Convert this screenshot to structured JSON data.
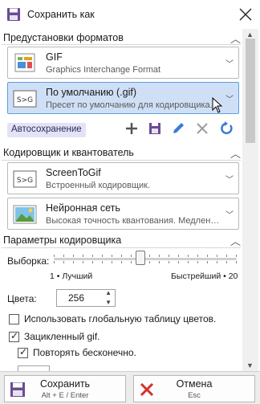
{
  "window": {
    "title": "Сохранить как"
  },
  "presets": {
    "header": "Предустановки форматов",
    "format": {
      "name": "GIF",
      "description": "Graphics Interchange Format"
    },
    "preset": {
      "name": "По умолчанию (.gif)",
      "description": "Пресет по умолчанию для кодировщика."
    },
    "autosave_label": "Автосохранение"
  },
  "encoder": {
    "header": "Кодировщик и квантователь",
    "encoder_item": {
      "name": "ScreenToGif",
      "description": "Встроенный кодировщик."
    },
    "quantizer_item": {
      "name": "Нейронная сеть",
      "description": "Высокая точность квантования. Медлен…"
    }
  },
  "params": {
    "header": "Параметры кодировщика",
    "sampling_label": "Выборка:",
    "sampling_min": "1 • Лучший",
    "sampling_max": "Быстрейший • 20",
    "sampling_value": 10,
    "colors_label": "Цвета:",
    "colors_value": "256",
    "global_table_label": "Использовать глобальную таблицу цветов.",
    "global_table_checked": false,
    "looped_label": "Зацикленный gif.",
    "looped_checked": true,
    "repeat_forever_label": "Повторять бесконечно.",
    "repeat_forever_checked": true
  },
  "footer": {
    "save_label": "Сохранить",
    "save_shortcut": "Alt + E / Enter",
    "cancel_label": "Отмена",
    "cancel_shortcut": "Esc"
  },
  "colors": {
    "accent": "#5b9ee0",
    "save_icon": "#6a4c93",
    "cancel_icon": "#d4302b",
    "selection": "#cfe0f6"
  }
}
